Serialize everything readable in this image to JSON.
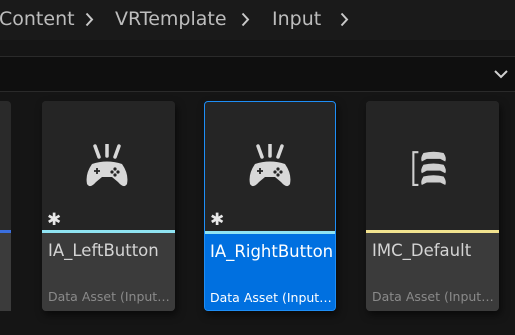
{
  "breadcrumb": {
    "items": [
      "Content",
      "VRTemplate",
      "Input"
    ]
  },
  "assets": [
    {
      "name": "IA_LeftButton",
      "type": "Data Asset (Input…",
      "stripe_color": "#8fe3f2",
      "icon": "gamepad-icon",
      "modified_marker": "✱"
    },
    {
      "name": "IA_RightButton",
      "type": "Data Asset (Input…",
      "stripe_color": "#8fe3f2",
      "icon": "gamepad-icon",
      "modified_marker": "✱"
    },
    {
      "name": "IMC_Default",
      "type": "Data Asset (Input…",
      "stripe_color": "#f2e38f",
      "icon": "input-mapping-stack-icon"
    }
  ],
  "partial_tile_stripe_color": "#3a6fe0",
  "selection_color": "#0070e0"
}
